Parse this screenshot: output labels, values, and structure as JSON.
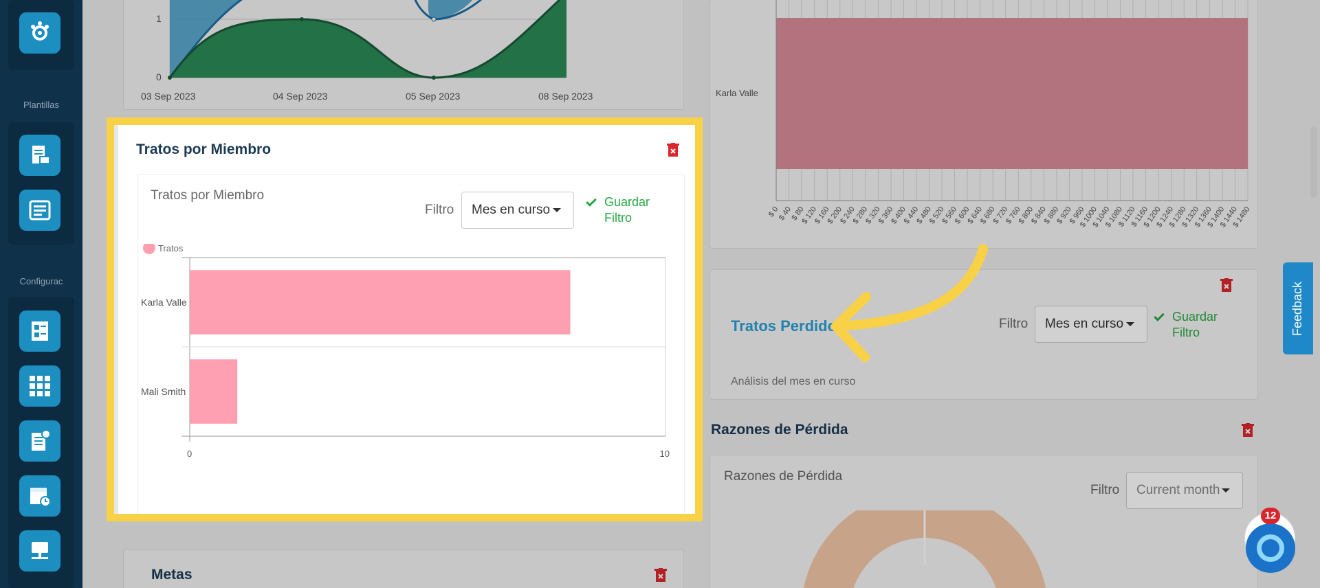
{
  "sidebar": {
    "section_templates": "Plantillas",
    "section_config": "Configurac",
    "icons": [
      "team-gear-icon",
      "document-mail-icon",
      "form-template-icon",
      "form-settings-icon",
      "grid-icon",
      "invoice-dollar-icon",
      "calendar-clock-icon",
      "computer-network-icon"
    ]
  },
  "line_chart": {
    "y_ticks": [
      "1",
      "0"
    ],
    "x_ticks": [
      "03 Sep 2023",
      "04 Sep 2023",
      "05 Sep 2023",
      "08 Sep 2023"
    ]
  },
  "tratos_miembro": {
    "widget_title": "Tratos por Miembro",
    "panel_title": "Tratos por Miembro",
    "filter_label": "Filtro",
    "filter_value": "Mes en curso",
    "save_filter_line1": "Guardar",
    "save_filter_line2": "Filtro"
  },
  "chart_data": {
    "type": "bar",
    "orientation": "horizontal",
    "categories": [
      "Karla Valle",
      "Mali Smith"
    ],
    "series": [
      {
        "name": "Tratos",
        "values": [
          8,
          1
        ],
        "color": "#ff9fb2"
      }
    ],
    "xlim": [
      0,
      10
    ],
    "x_ticks": [
      "0",
      "10"
    ],
    "legend": "top-left"
  },
  "top_right_chart": {
    "category": "Karla Valle",
    "x_ticks": [
      "$ 0",
      "$ 40",
      "$ 80",
      "$ 120",
      "$ 160",
      "$ 200",
      "$ 240",
      "$ 280",
      "$ 320",
      "$ 360",
      "$ 400",
      "$ 440",
      "$ 480",
      "$ 520",
      "$ 560",
      "$ 600",
      "$ 640",
      "$ 680",
      "$ 720",
      "$ 760",
      "$ 800",
      "$ 840",
      "$ 880",
      "$ 920",
      "$ 960",
      "$ 1000",
      "$ 1040",
      "$ 1080",
      "$ 1120",
      "$ 1160",
      "$ 1200",
      "$ 1240",
      "$ 1280",
      "$ 1320",
      "$ 1360",
      "$ 1400",
      "$ 1440",
      "$ 1480"
    ]
  },
  "tratos_perdido": {
    "title": "Tratos Perdido",
    "filter_label": "Filtro",
    "filter_value": "Mes en curso",
    "save_filter_line1": "Guardar",
    "save_filter_line2": "Filtro",
    "subtitle": "Análisis del mes en curso"
  },
  "razones": {
    "widget_title": "Razones de Pérdida",
    "panel_title": "Razones de Pérdida",
    "filter_label": "Filtro",
    "filter_value": "Current month"
  },
  "metas": {
    "widget_title": "Metas"
  },
  "feedback_label": "Feedback",
  "chat_badge": "12",
  "colors": {
    "accent": "#1c8fc0",
    "highlight": "#f8d147",
    "bar": "#ff9fb2",
    "success": "#27a844",
    "danger": "#d9262d"
  }
}
